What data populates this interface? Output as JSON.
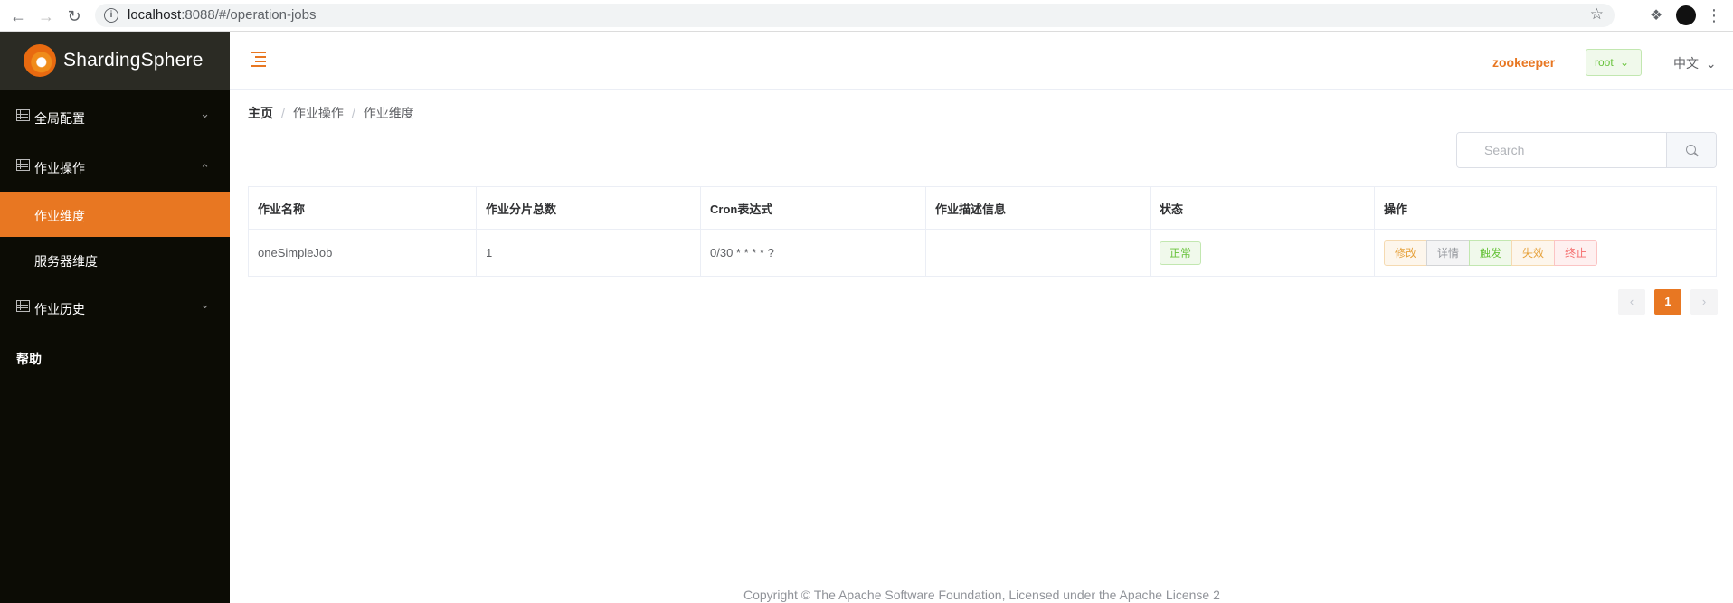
{
  "browser": {
    "url_host": "localhost",
    "url_rest": ":8088/#/operation-jobs"
  },
  "sidebar": {
    "logo_text": "ShardingSphere",
    "items": [
      {
        "label": "全局配置"
      },
      {
        "label": "作业操作"
      },
      {
        "label": "作业维度"
      },
      {
        "label": "服务器维度"
      },
      {
        "label": "作业历史"
      },
      {
        "label": "帮助"
      }
    ]
  },
  "header": {
    "registry": "zookeeper",
    "user": "root",
    "language": "中文"
  },
  "breadcrumb": [
    "主页",
    "作业操作",
    "作业维度"
  ],
  "search": {
    "placeholder": "Search"
  },
  "table": {
    "columns": [
      "作业名称",
      "作业分片总数",
      "Cron表达式",
      "作业描述信息",
      "状态",
      "操作"
    ],
    "rows": [
      {
        "name": "oneSimpleJob",
        "shards": "1",
        "cron": "0/30 * * * * ?",
        "desc": "",
        "status": "正常"
      }
    ],
    "actions": [
      {
        "label": "修改",
        "color": "#e6a23c"
      },
      {
        "label": "详情",
        "color": "#909399"
      },
      {
        "label": "触发",
        "color": "#67c23a"
      },
      {
        "label": "失效",
        "color": "#e6a23c"
      },
      {
        "label": "终止",
        "color": "#f56c6c"
      }
    ]
  },
  "pagination": {
    "current": "1"
  },
  "footer": "Copyright © The Apache Software Foundation, Licensed under the Apache License 2",
  "colors": {
    "accent": "#e87722",
    "sidebar_bg": "#0c0c05"
  }
}
